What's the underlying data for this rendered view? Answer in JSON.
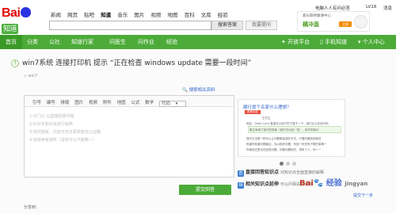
{
  "header": {
    "logo_text": "Bai",
    "logo_suffix": "知道",
    "nav": [
      "新闻",
      "网页",
      "贴吧",
      "知道",
      "音乐",
      "图片",
      "视频",
      "地图",
      "百科",
      "文库",
      "经验"
    ],
    "search_button": "搜索答案",
    "ask_button": "我要提问",
    "user_links": [
      "电脑人人有问必答",
      "LV18",
      "消息"
    ],
    "ad": {
      "title": "家长期待跟课中心",
      "main": "横冲直",
      "button": "立即",
      "aux": "日活跃"
    }
  },
  "navbar": {
    "items": [
      "首页",
      "分类",
      "公社",
      "知道行家",
      "问医生",
      "问作业",
      "经验"
    ],
    "right_items": [
      "开放平台",
      "手机知道",
      "个人中心"
    ]
  },
  "question": {
    "title": "win7系统 连接打印机 提示 “正在检查 windows update 需要一段时间”",
    "tag": "win7",
    "search_link": "搜索相关资料"
  },
  "editor": {
    "toolbar": [
      "引号",
      "编号",
      "排版",
      "图片",
      "视频",
      "附件",
      "地图",
      "公式",
      "数学"
    ],
    "code_select": "代码",
    "hints": [
      "1.只门以,以直接回答问题",
      "2.针对长知识点进行延伸",
      "3.现问题板，内容与无法更高度法以证确",
      "4.有效参考资料（没有可以不能略~）"
    ],
    "submit": "提交回答",
    "share": "分享到："
  },
  "sidebar": {
    "question": "肆行提个名家什么理想？",
    "tag": "推荐回答",
    "lines": [
      "王先生",
      "网友：ZebA Card 直接可以用户的下直于一下，我们认为手段代码",
      "楼主采纳了我方的答案（我们可以回一些），知平的就中",
      "提问方法是一种可以让问题更高效的方式，只要问题找到就好",
      "知道你知道问题最近，加以相关问题，有回一份还有下数的事情一",
      "你使用这里也在回答问题，你看问题相关，得来了人，你一一"
    ],
    "features": [
      {
        "icon": "直",
        "title": "直接回答知识点",
        "sub": "对知识点全面直接的解释"
      },
      {
        "icon": "相",
        "title": "相关知识点延伸",
        "sub": "可以问相关知识点"
      }
    ],
    "more_link": "提交下一步"
  },
  "watermark": {
    "main": "jingyan",
    "accent": "Bai",
    "cn": "经验"
  }
}
